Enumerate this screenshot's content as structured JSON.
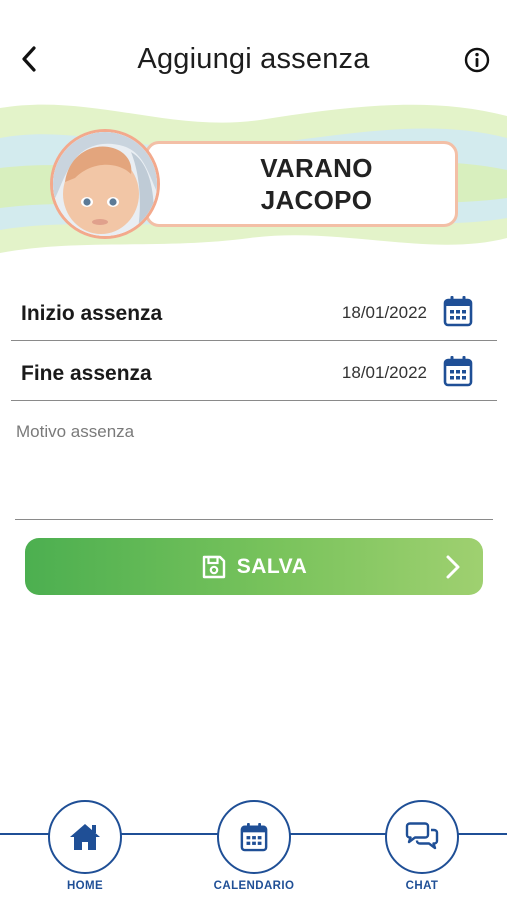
{
  "header": {
    "title": "Aggiungi assenza",
    "back_icon": "chevron-left-icon",
    "info_icon": "info-circle-icon"
  },
  "child": {
    "first_line": "VARANO",
    "second_line": "JACOPO"
  },
  "form": {
    "start": {
      "label": "Inizio assenza",
      "date": "18/01/2022",
      "icon": "calendar-icon"
    },
    "end": {
      "label": "Fine assenza",
      "date": "18/01/2022",
      "icon": "calendar-icon"
    },
    "reason": {
      "placeholder": "Motivo assenza",
      "value": ""
    }
  },
  "save_button": {
    "label": "SALVA",
    "icon": "floppy-disk-icon",
    "arrow_icon": "chevron-right-icon"
  },
  "bottom_nav": {
    "items": [
      {
        "label": "HOME",
        "icon": "home-icon"
      },
      {
        "label": "CALENDARIO",
        "icon": "calendar-icon"
      },
      {
        "label": "CHAT",
        "icon": "chat-bubbles-icon"
      }
    ]
  },
  "colors": {
    "brand_blue": "#1f4f96",
    "green_start": "#4caf50",
    "green_end": "#9fd070",
    "card_border": "#f3bfa6",
    "avatar_border": "#f3a98c",
    "wave_green": "#d8efb8",
    "wave_blue": "#cfe6f7"
  }
}
